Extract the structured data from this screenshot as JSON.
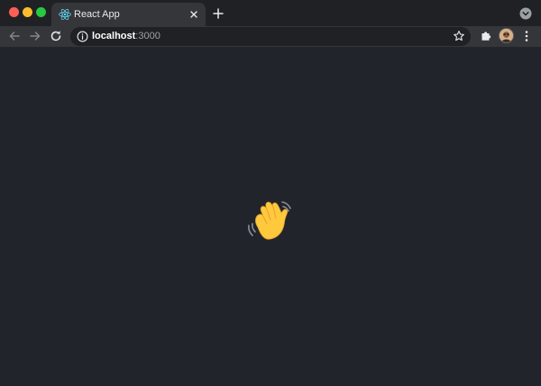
{
  "tab": {
    "title": "React App"
  },
  "address": {
    "host": "localhost",
    "port": ":3000"
  },
  "colors": {
    "react_logo": "#61dafb",
    "wave_hand": "#ffc83d",
    "page_bg": "#22242b"
  },
  "icons": {
    "back": "arrow-left-icon",
    "forward": "arrow-right-icon",
    "reload": "reload-icon",
    "info": "info-icon",
    "bookmark": "star-icon",
    "extensions": "puzzle-icon",
    "menu": "kebab-menu-icon",
    "content": "waving-hand-icon"
  }
}
